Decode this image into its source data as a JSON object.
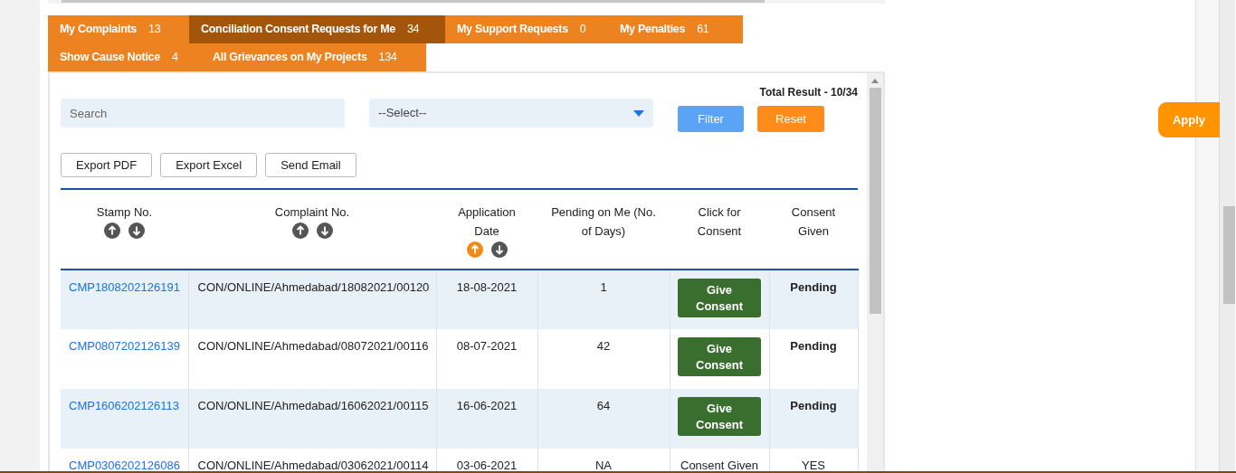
{
  "tabs": [
    {
      "label": "My Complaints",
      "count": "13",
      "selected": false
    },
    {
      "label": "Conciliation Consent Requests for Me",
      "count": "34",
      "selected": true
    },
    {
      "label": "My Support Requests",
      "count": "0",
      "selected": false
    },
    {
      "label": "My Penalties",
      "count": "61",
      "selected": false
    },
    {
      "label": "Show Cause Notice",
      "count": "4",
      "selected": false
    },
    {
      "label": "All Grievances on My Projects",
      "count": "134",
      "selected": false
    }
  ],
  "filters": {
    "search": {
      "placeholder": "Search"
    },
    "select": {
      "value": "--Select--"
    },
    "buttons": [
      {
        "label": "Filter",
        "kind": "filter"
      },
      {
        "label": "Reset",
        "kind": "reset"
      }
    ],
    "total_result": "Total Result - 10/34"
  },
  "export_buttons": [
    "Export PDF",
    "Export Excel",
    "Send Email"
  ],
  "apply_button": "Apply",
  "table": {
    "columns": [
      {
        "label": "Stamp No.",
        "sortable": true,
        "sorted_ascending": false
      },
      {
        "label": "Complaint No.",
        "sortable": true,
        "sorted_ascending": false
      },
      {
        "label": "Application Date",
        "sortable": true,
        "sorted_ascending": true
      },
      {
        "label": "Pending on Me (No. of Days)",
        "sortable": false
      },
      {
        "label": "Click for Consent",
        "sortable": false
      },
      {
        "label": "Consent Given",
        "sortable": false
      }
    ],
    "rows": [
      {
        "stamp_no": "CMP1808202126191",
        "complaint_no": "CON/ONLINE/Ahmedabad/18082021/00120",
        "application_date": "18-08-2021",
        "pending_days": "1",
        "consent": {
          "kind": "button",
          "label": "Give Consent"
        },
        "consent_given": {
          "text": "Pending",
          "bold": true
        }
      },
      {
        "stamp_no": "CMP0807202126139",
        "complaint_no": "CON/ONLINE/Ahmedabad/08072021/00116",
        "application_date": "08-07-2021",
        "pending_days": "42",
        "consent": {
          "kind": "button",
          "label": "Give Consent"
        },
        "consent_given": {
          "text": "Pending",
          "bold": true
        }
      },
      {
        "stamp_no": "CMP1606202126113",
        "complaint_no": "CON/ONLINE/Ahmedabad/16062021/00115",
        "application_date": "16-06-2021",
        "pending_days": "64",
        "consent": {
          "kind": "button",
          "label": "Give Consent"
        },
        "consent_given": {
          "text": "Pending",
          "bold": true
        }
      },
      {
        "stamp_no": "CMP0306202126086",
        "complaint_no": "CON/ONLINE/Ahmedabad/03062021/00114",
        "application_date": "03-06-2021",
        "pending_days": "NA",
        "consent": {
          "kind": "text",
          "label": "Consent Given"
        },
        "consent_given": {
          "text": "YES",
          "bold": false
        }
      }
    ]
  }
}
